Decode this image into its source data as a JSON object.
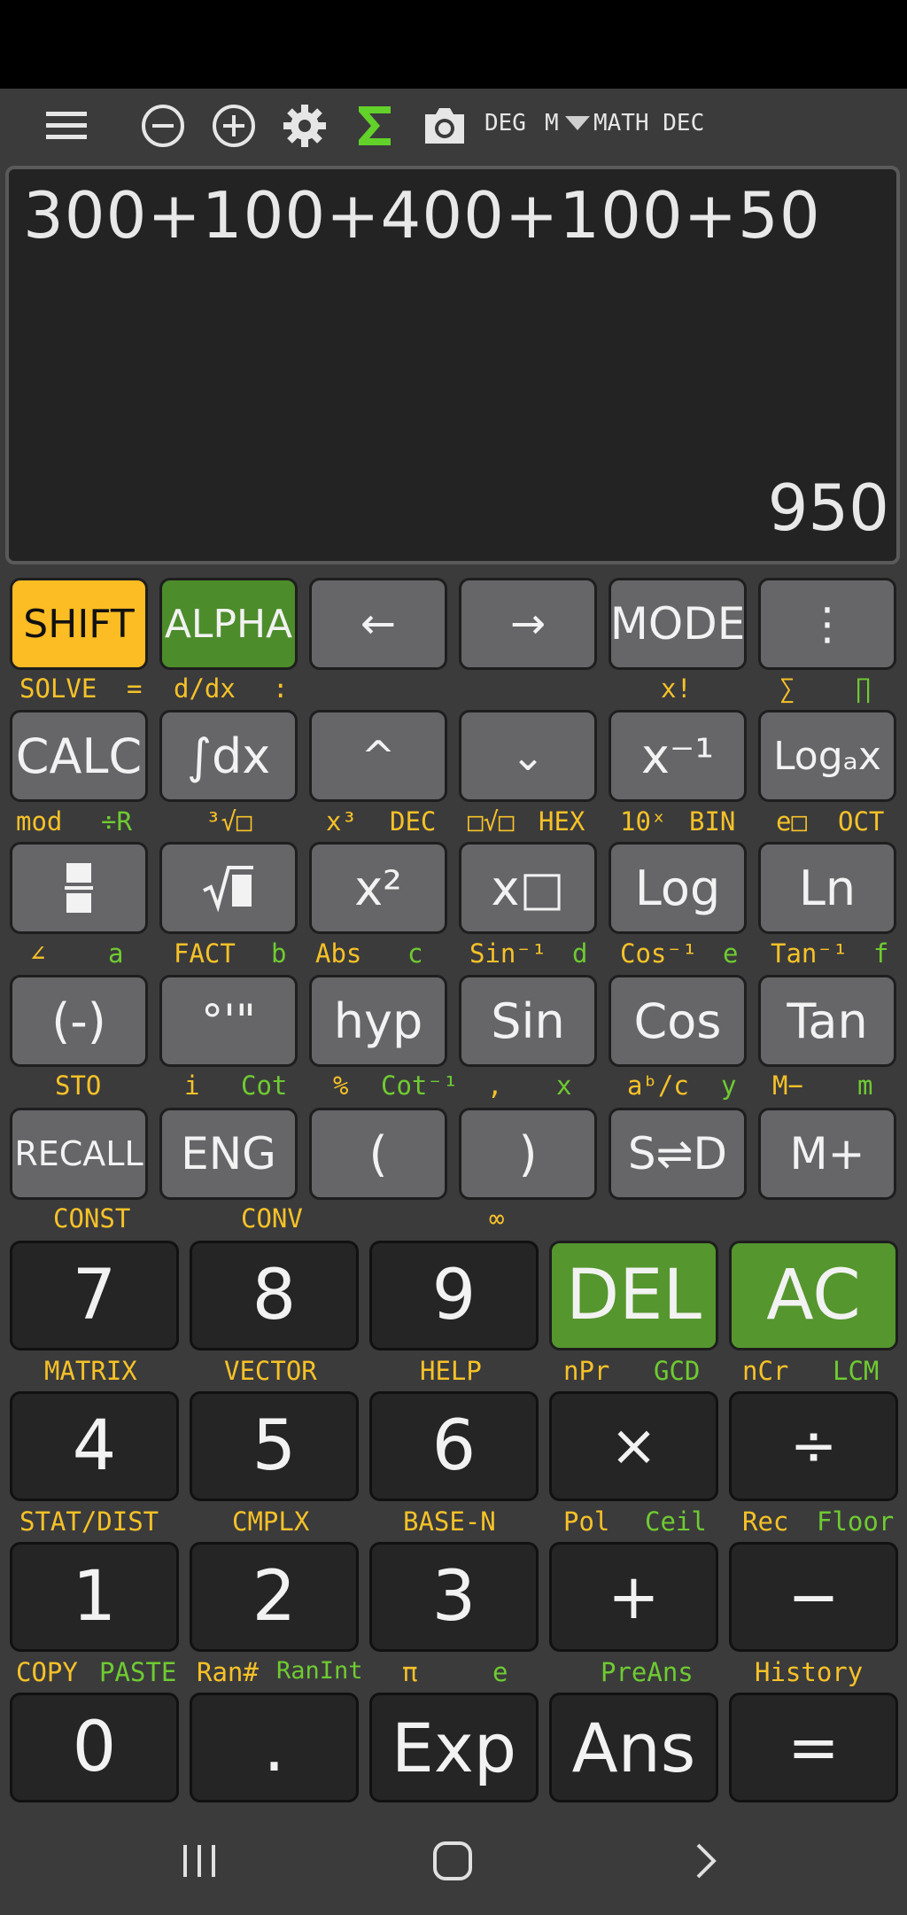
{
  "toolbar": {
    "angle_mode": "DEG",
    "memory": "M",
    "mode_text": "MATH DEC",
    "icons": [
      "menu-icon",
      "zoom-out-icon",
      "zoom-in-icon",
      "gear-icon",
      "sigma-icon",
      "camera-icon",
      "dropdown-icon"
    ]
  },
  "display": {
    "expression": "300+100+400+100+50",
    "result": "950"
  },
  "keys": {
    "r1": [
      "SHIFT",
      "ALPHA",
      "←",
      "→",
      "MODE",
      "⋮"
    ],
    "r2": [
      "CALC",
      "∫dx",
      "^",
      "⌄",
      "x⁻¹",
      "Logₐx"
    ],
    "r3": [
      "▬",
      "√▮",
      "x²",
      "x□",
      "Log",
      "Ln"
    ],
    "r4": [
      "(-)",
      "°'\"",
      "hyp",
      "Sin",
      "Cos",
      "Tan"
    ],
    "r5": [
      "RECALL",
      "ENG",
      "(",
      ")",
      "S⇌D",
      "M+"
    ],
    "n1": [
      "7",
      "8",
      "9",
      "DEL",
      "AC"
    ],
    "n2": [
      "4",
      "5",
      "6",
      "×",
      "÷"
    ],
    "n3": [
      "1",
      "2",
      "3",
      "+",
      "−"
    ],
    "n4": [
      "0",
      ".",
      "Exp",
      "Ans",
      "="
    ]
  },
  "labels": {
    "l1": {
      "solve": "SOLVE",
      "eq": "=",
      "ddx": "d/dx",
      "colon": ":",
      "fact": "x!",
      "sum": "∑",
      "prod": "∏"
    },
    "l2": {
      "mod": "mod",
      "divr": "÷R",
      "cbrt": "³√□",
      "x3": "x³",
      "dec": "DEC",
      "nrt": "□√□",
      "hex": "HEX",
      "tenx": "10ˣ",
      "bin": "BIN",
      "epow": "e□",
      "oct": "OCT"
    },
    "l3": {
      "angle": "∠",
      "a": "a",
      "fact": "FACT",
      "b": "b",
      "abs": "Abs",
      "c": "c",
      "asin": "Sin⁻¹",
      "d": "d",
      "acos": "Cos⁻¹",
      "e": "e",
      "atan": "Tan⁻¹",
      "f": "f"
    },
    "l4": {
      "sto": "STO",
      "i": "i",
      "cot": "Cot",
      "pct": "%",
      "acot": "Cot⁻¹",
      "comma": ",",
      "x": "x",
      "frac": "aᵇ/c",
      "y": "y",
      "mminus": "M−",
      "m": "m"
    },
    "l5": {
      "const": "CONST",
      "conv": "CONV",
      "inf": "∞"
    },
    "l6": {
      "matrix": "MATRIX",
      "vector": "VECTOR",
      "help": "HELP",
      "npr": "nPr",
      "gcd": "GCD",
      "ncr": "nCr",
      "lcm": "LCM"
    },
    "l7": {
      "stat": "STAT/DIST",
      "cmplx": "CMPLX",
      "basen": "BASE-N",
      "pol": "Pol",
      "ceil": "Ceil",
      "rec": "Rec",
      "floor": "Floor"
    },
    "l8": {
      "copy": "COPY",
      "paste": "PASTE",
      "ran": "Ran#",
      "ranint": "RanInt",
      "pi": "π",
      "e": "e",
      "preans": "PreAns",
      "history": "History"
    }
  },
  "nav": {
    "recents": "|||",
    "home": "○",
    "back": "›"
  }
}
